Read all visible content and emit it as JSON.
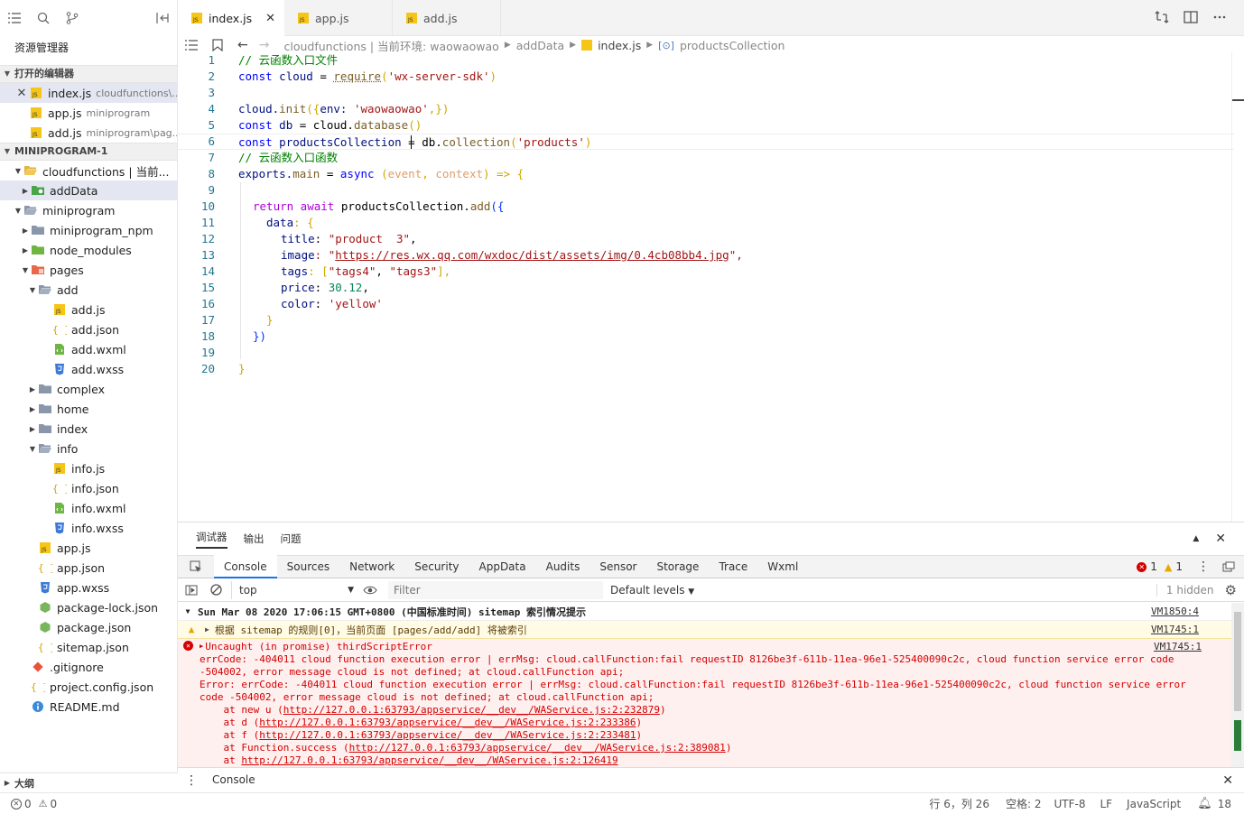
{
  "sidebar": {
    "title": "资源管理器",
    "open_editors_label": "打开的编辑器",
    "open_editors": [
      {
        "name": "index.js",
        "hint": "cloudfunctions\\..."
      },
      {
        "name": "app.js",
        "hint": "miniprogram"
      },
      {
        "name": "add.js",
        "hint": "miniprogram\\pag..."
      }
    ],
    "project_label": "MINIPROGRAM-1",
    "tree": [
      {
        "name": "cloudfunctions | 当前...",
        "type": "cloud-folder"
      },
      {
        "name": "addData",
        "type": "cloud-fn-folder"
      },
      {
        "name": "miniprogram",
        "type": "folder-open"
      },
      {
        "name": "miniprogram_npm",
        "type": "folder"
      },
      {
        "name": "node_modules",
        "type": "npm-folder"
      },
      {
        "name": "pages",
        "type": "pages-folder"
      },
      {
        "name": "add",
        "type": "folder-open"
      },
      {
        "name": "add.js",
        "type": "js"
      },
      {
        "name": "add.json",
        "type": "json"
      },
      {
        "name": "add.wxml",
        "type": "wxml"
      },
      {
        "name": "add.wxss",
        "type": "wxss"
      },
      {
        "name": "complex",
        "type": "folder"
      },
      {
        "name": "home",
        "type": "folder"
      },
      {
        "name": "index",
        "type": "folder"
      },
      {
        "name": "info",
        "type": "folder-open"
      },
      {
        "name": "info.js",
        "type": "js"
      },
      {
        "name": "info.json",
        "type": "json"
      },
      {
        "name": "info.wxml",
        "type": "wxml"
      },
      {
        "name": "info.wxss",
        "type": "wxss"
      },
      {
        "name": "app.js",
        "type": "js"
      },
      {
        "name": "app.json",
        "type": "json"
      },
      {
        "name": "app.wxss",
        "type": "wxss"
      },
      {
        "name": "package-lock.json",
        "type": "npm"
      },
      {
        "name": "package.json",
        "type": "npm"
      },
      {
        "name": "sitemap.json",
        "type": "json"
      },
      {
        "name": ".gitignore",
        "type": "git"
      },
      {
        "name": "project.config.json",
        "type": "json"
      },
      {
        "name": "README.md",
        "type": "info"
      }
    ],
    "outline_label": "大纲"
  },
  "tabs": [
    {
      "label": "index.js"
    },
    {
      "label": "app.js"
    },
    {
      "label": "add.js"
    }
  ],
  "breadcrumb": {
    "env": "cloudfunctions | 当前环境: waowaowao",
    "folder": "addData",
    "file": "index.js",
    "symbol": "productsCollection"
  },
  "code": {
    "line_numbers": [
      "1",
      "2",
      "3",
      "4",
      "5",
      "6",
      "7",
      "8",
      "9",
      "10",
      "11",
      "12",
      "13",
      "14",
      "15",
      "16",
      "17",
      "18",
      "19",
      "20"
    ],
    "l1": "// 云函数入口文件",
    "l2": {
      "a": "const",
      "b": " cloud ",
      "c": "= ",
      "d": "require",
      "e": "(",
      "f": "'wx-server-sdk'",
      "g": ")"
    },
    "l4": {
      "a": "cloud.",
      "b": "init",
      "c": "({",
      "d": "env: ",
      "e": "'waowaowao'",
      "f": ",})"
    },
    "l5": {
      "a": "const",
      "b": " db ",
      "c": "= cloud.",
      "d": "database",
      "e": "()"
    },
    "l6": {
      "a": "const",
      "b": " productsCollection ",
      "c": "= db.",
      "d": "collection",
      "e": "(",
      "f": "'products'",
      "g": ")"
    },
    "l7": "// 云函数入口函数",
    "l8": {
      "a": "exports.",
      "b": "main",
      "c": " = ",
      "d": "async",
      "e": " (",
      "f": "event",
      "g": ", ",
      "h": "context",
      "i": ") => {"
    },
    "l10": {
      "a": "return",
      "b": " await",
      "c": " productsCollection.",
      "d": "add",
      "e": "({"
    },
    "l11": {
      "a": "data",
      "b": ": {"
    },
    "l12": {
      "a": "title",
      "b": ": ",
      "c": "\"product  3\"",
      "d": ","
    },
    "l13": {
      "a": "image",
      "b": ": \"",
      "c": "https://res.wx.qq.com/wxdoc/dist/assets/img/0.4cb08bb4.jpg",
      "d": "\","
    },
    "l14": {
      "a": "tags",
      "b": ": [",
      "c": "\"tags4\"",
      "d": ", ",
      "e": "\"tags3\"",
      "f": "],"
    },
    "l15": {
      "a": "price",
      "b": ": ",
      "c": "30.12",
      "d": ","
    },
    "l16": {
      "a": "color",
      "b": ": ",
      "c": "'yellow'"
    },
    "l17": "}",
    "l18": "})",
    "l20": "}"
  },
  "devtools": {
    "top_tabs": [
      "调试器",
      "输出",
      "问题"
    ],
    "tabs": [
      "Console",
      "Sources",
      "Network",
      "Security",
      "AppData",
      "Audits",
      "Sensor",
      "Storage",
      "Trace",
      "Wxml"
    ],
    "error_count": "1",
    "warn_count": "1",
    "context": "top",
    "filter_placeholder": "Filter",
    "levels": "Default levels",
    "hidden": "1 hidden",
    "console": {
      "group": "Sun Mar 08 2020 17:06:15 GMT+0800 (中国标准时间) sitemap 索引情况提示",
      "group_src": "VM1850:4",
      "warn": "根据 sitemap 的规则[0]，当前页面 [pages/add/add] 将被索引",
      "warn_src": "VM1745:1",
      "err_head": "Uncaught (in promise) thirdScriptError",
      "err_src": "VM1745:1",
      "err_lines": [
        "errCode: -404011 cloud function execution error | errMsg: cloud.callFunction:fail requestID 8126be3f-611b-11ea-96e1-525400090c2c, cloud function service error code",
        "-504002, error message cloud is not defined; at cloud.callFunction api;",
        "Error: errCode: -404011 cloud function execution error | errMsg: cloud.callFunction:fail requestID 8126be3f-611b-11ea-96e1-525400090c2c, cloud function service error",
        "code -504002, error message cloud is not defined; at cloud.callFunction api;"
      ],
      "stack": [
        {
          "pre": "    at new u (",
          "link": "http://127.0.0.1:63793/appservice/__dev__/WAService.js:2:232879",
          "post": ")"
        },
        {
          "pre": "    at d (",
          "link": "http://127.0.0.1:63793/appservice/__dev__/WAService.js:2:233386",
          "post": ")"
        },
        {
          "pre": "    at f (",
          "link": "http://127.0.0.1:63793/appservice/__dev__/WAService.js:2:233481",
          "post": ")"
        },
        {
          "pre": "    at Function.success (",
          "link": "http://127.0.0.1:63793/appservice/__dev__/WAService.js:2:389081",
          "post": ")"
        },
        {
          "pre": "    at ",
          "link": "http://127.0.0.1:63793/appservice/__dev__/WAService.js:2:126419",
          "post": ""
        }
      ]
    },
    "bottom_tab": "Console"
  },
  "status": {
    "errors": "0",
    "warnings": "0",
    "position": "行 6，列 26",
    "indent": "空格: 2",
    "encoding": "UTF-8",
    "eol": "LF",
    "language": "JavaScript",
    "notifications": "18"
  },
  "colors": {
    "accent": "#1a73e8",
    "error": "#d40000",
    "js_icon": "#f5c518"
  }
}
